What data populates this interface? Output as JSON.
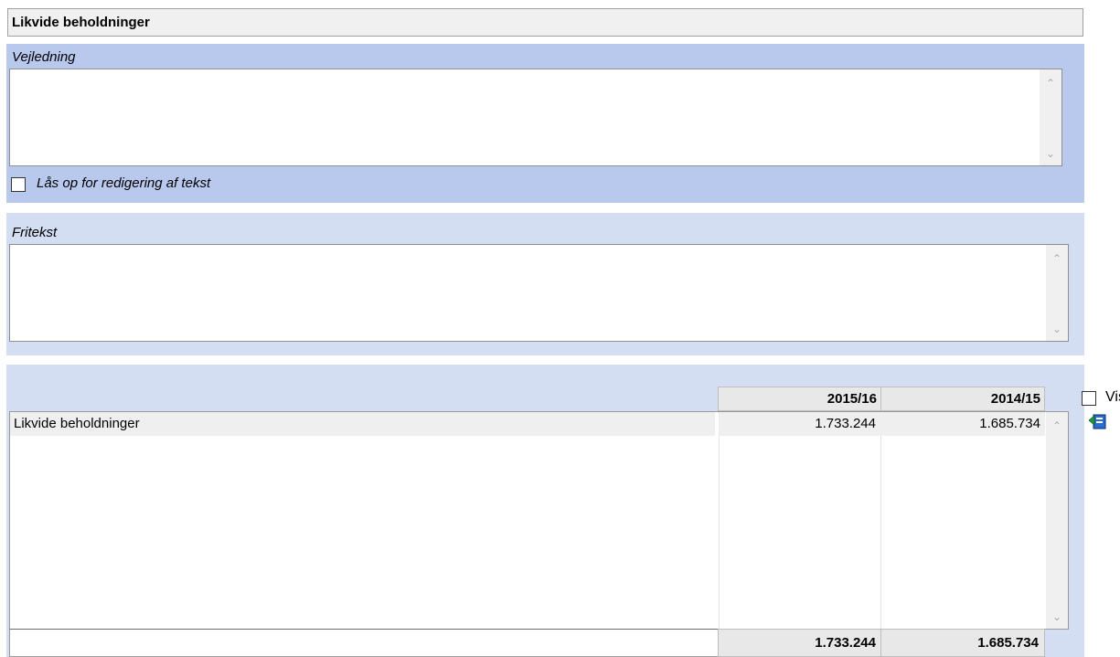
{
  "title": "Likvide beholdninger",
  "guidance": {
    "label": "Vejledning",
    "text": "",
    "unlock_label": "Lås op for redigering af tekst",
    "unlock_checked": false
  },
  "freetext": {
    "label": "Fritekst",
    "text": ""
  },
  "table": {
    "columns": [
      "2015/16",
      "2014/15"
    ],
    "rows": [
      {
        "label": "Likvide beholdninger",
        "values": [
          "1.733.244",
          "1.685.734"
        ]
      }
    ],
    "totals": [
      "1.733.244",
      "1.685.734"
    ],
    "show_label": "Vis",
    "show_checked": false
  },
  "icons": {
    "scroll_up": "chevron-up-icon",
    "scroll_down": "chevron-down-icon",
    "export": "export-icon"
  }
}
